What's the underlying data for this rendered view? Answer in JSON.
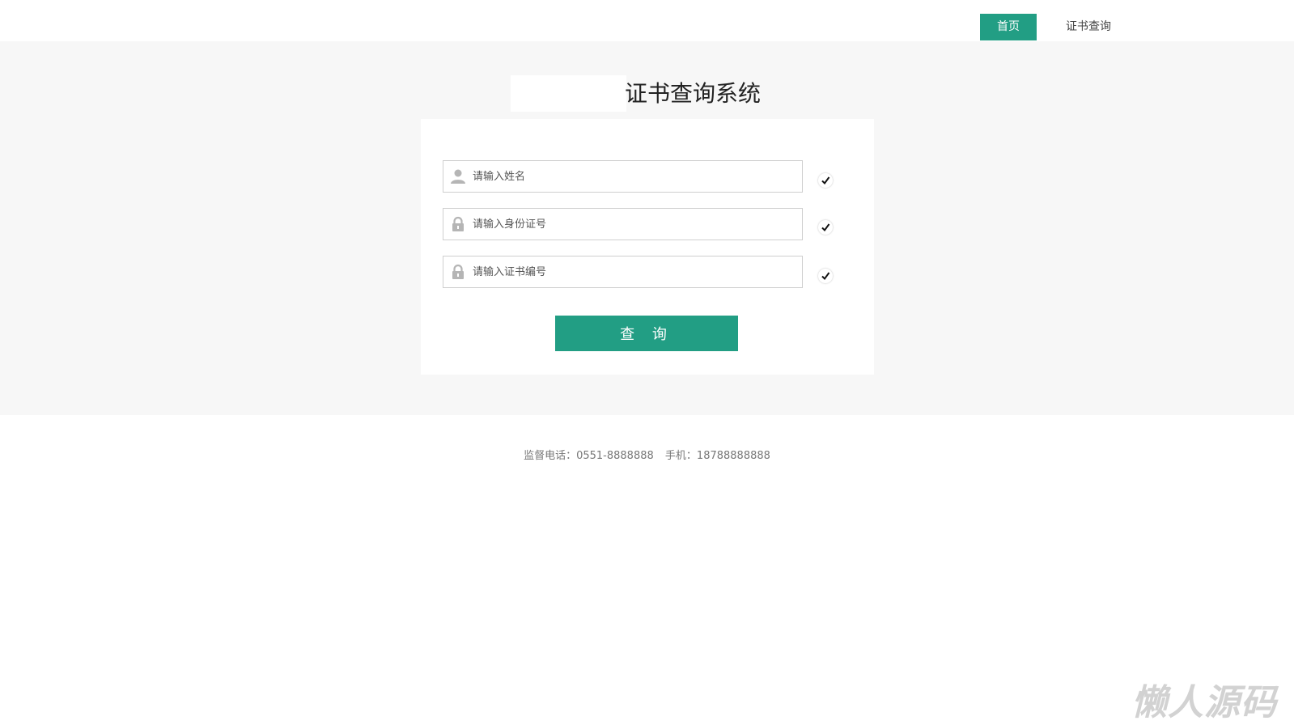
{
  "nav": {
    "items": [
      {
        "label": "首页",
        "active": true
      },
      {
        "label": "证书查询",
        "active": false
      }
    ]
  },
  "page": {
    "title": "证书查询系统"
  },
  "form": {
    "fields": [
      {
        "placeholder": "请输入姓名",
        "icon": "user-icon",
        "value": ""
      },
      {
        "placeholder": "请输入身份证号",
        "icon": "lock-icon",
        "value": ""
      },
      {
        "placeholder": "请输入证书编号",
        "icon": "lock-icon",
        "value": ""
      }
    ],
    "submit_label": "查 询"
  },
  "footer": {
    "phone": "监督电话：0551-8888888",
    "mobile": "手机：18788888888"
  },
  "watermark": "懒人源码",
  "colors": {
    "accent": "#229e84",
    "band_bg": "#f7f7f7"
  }
}
